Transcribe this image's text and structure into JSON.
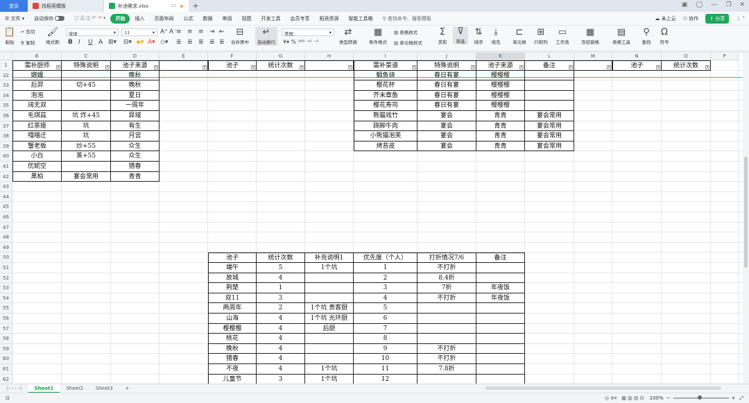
{
  "tabs": {
    "home": "首页",
    "t2": "找稻壳模板",
    "t3": "补池需求.xlsx"
  },
  "menu": {
    "file": "文件",
    "autosave": "自动保存",
    "start": "开始",
    "insert": "插入",
    "layout": "页面布局",
    "formula": "公式",
    "data": "数据",
    "review": "审阅",
    "view": "视图",
    "dev": "开发工具",
    "member": "会员专享",
    "docer": "稻壳资源",
    "smart": "智能工具箱",
    "search": "查找命令、搜索模板",
    "cloud": "未上云",
    "collab": "协作",
    "share": "分享"
  },
  "ribbon": {
    "paste": "粘贴",
    "cut": "剪切",
    "copy": "复制",
    "format_painter": "格式刷",
    "font_name": "宋体",
    "font_size": "11",
    "merge": "合并居中",
    "wrap": "自动换行",
    "num_format": "常规",
    "type_convert": "类型转换",
    "cond_format": "条件格式",
    "table_style": "表格样式",
    "cell_style": "单元格样式",
    "sum": "求和",
    "filter": "筛选",
    "sort": "排序",
    "fill": "填充",
    "cell": "单元格",
    "rowcol": "行和列",
    "worksheet": "工作表",
    "freeze": "冻结窗格",
    "table_tools": "表格工具",
    "find": "查找",
    "symbol": "符号"
  },
  "columns": [
    "B",
    "C",
    "D",
    "E",
    "F",
    "G",
    "H",
    "I",
    "J",
    "K",
    "L",
    "M",
    "N",
    "O",
    "P"
  ],
  "rows": [
    "1",
    "32",
    "33",
    "34",
    "35",
    "36",
    "37",
    "38",
    "39",
    "40",
    "41",
    "42",
    "43",
    "44",
    "45",
    "46",
    "47",
    "48",
    "49",
    "50",
    "51",
    "52",
    "53",
    "54",
    "55",
    "56",
    "57",
    "58",
    "59",
    "60",
    "61",
    "62"
  ],
  "row1": {
    "B": "需补厨师",
    "C": "特殊说明",
    "D": "池子来源",
    "F": "池子",
    "G": "统计次数",
    "I": "需补菜谱",
    "J": "特殊说明",
    "K": "池子来源",
    "L": "备注",
    "N": "池子",
    "O": "统计次数"
  },
  "table1": [
    [
      "嫦娥",
      "",
      "晚秋"
    ],
    [
      "后羿",
      "切+45",
      "晚秋"
    ],
    [
      "泡泡",
      "",
      "夏日"
    ],
    [
      "阔无双",
      "",
      "一周年"
    ],
    [
      "毛琪茲",
      "坑 炸+45",
      "异域"
    ],
    [
      "红茶姬",
      "坑",
      "有生"
    ],
    [
      "嘎喵迁",
      "坑",
      "月宫"
    ],
    [
      "蟹老板",
      "炒+55",
      "众生"
    ],
    [
      "小白",
      "蒸+55",
      "众生"
    ],
    [
      "优妮空",
      "",
      "猎春"
    ],
    [
      "黑柏",
      "宴会常用",
      "青青"
    ]
  ],
  "table2": [
    [
      "鲷鱼烧",
      "春日有宴",
      "樱樱樱",
      ""
    ],
    [
      "樱花杯",
      "春日有宴",
      "樱樱樱",
      ""
    ],
    [
      "芥末章鱼",
      "春日有宴",
      "樱樱樱",
      ""
    ],
    [
      "樱花寿司",
      "春日有宴",
      "樱樱樱",
      ""
    ],
    [
      "熊猫戏竹",
      "宴会",
      "青青",
      "宴会常用"
    ],
    [
      "跷脚牛肉",
      "宴会",
      "青青",
      "宴会常用"
    ],
    [
      "小熊猫泡芙",
      "宴会",
      "青青",
      "宴会常用"
    ],
    [
      "烤苔皮",
      "宴会",
      "青青",
      "宴会常用"
    ]
  ],
  "table3_header": [
    "池子",
    "统计次数",
    "补充说明1",
    "优先度（个人）",
    "打折情况7/6",
    "备注"
  ],
  "table3": [
    [
      "端午",
      "5",
      "1个坑",
      "1",
      "不打折",
      ""
    ],
    [
      "故城",
      "4",
      "",
      "2",
      "8.4折",
      ""
    ],
    [
      "荆楚",
      "1",
      "",
      "3",
      "7折",
      "年夜饭"
    ],
    [
      "双11",
      "3",
      "",
      "4",
      "不打折",
      "年夜饭"
    ],
    [
      "两周年",
      "2",
      "1个坑 贵客厨",
      "5",
      "",
      ""
    ],
    [
      "山海",
      "4",
      "1个坑 光环厨",
      "6",
      "",
      ""
    ],
    [
      "樱樱樱",
      "4",
      "后厨",
      "7",
      "",
      ""
    ],
    [
      "桃花",
      "4",
      "",
      "8",
      "",
      ""
    ],
    [
      "晚秋",
      "4",
      "",
      "9",
      "不打折",
      ""
    ],
    [
      "猎春",
      "4",
      "",
      "10",
      "不打折",
      ""
    ],
    [
      "不夜",
      "4",
      "1个坑",
      "11",
      "7.8折",
      ""
    ],
    [
      "儿童节",
      "3",
      "1个坑",
      "12",
      "",
      ""
    ]
  ],
  "sheets": [
    "Sheet1",
    "Sheet2",
    "Sheet3"
  ],
  "zoom": "100%"
}
